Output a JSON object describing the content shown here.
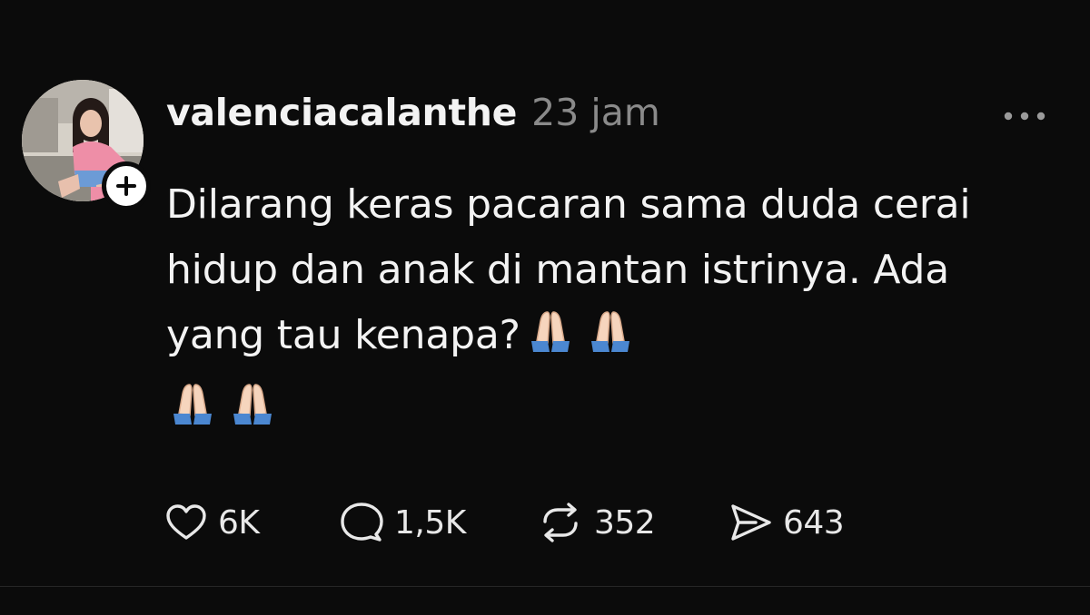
{
  "post": {
    "username": "valenciacalanthe",
    "time": "23 jam",
    "text": "Dilarang keras pacaran sama duda cerai hidup dan anak di mantan istrinya. Ada yang tau kenapa?",
    "emoji_count": 4,
    "icons": {
      "avatar": "profile-photo",
      "follow": "plus-icon",
      "more": "more-horizontal-icon",
      "emoji": "folded-hands-emoji"
    }
  },
  "actions": {
    "like": {
      "icon": "heart-icon",
      "count": "6K"
    },
    "reply": {
      "icon": "comment-icon",
      "count": "1,5K"
    },
    "repost": {
      "icon": "repost-icon",
      "count": "352"
    },
    "share": {
      "icon": "send-icon",
      "count": "643"
    }
  },
  "colors": {
    "background": "#0b0b0b",
    "text": "#f3f3f3",
    "muted": "#8a8a8a"
  }
}
